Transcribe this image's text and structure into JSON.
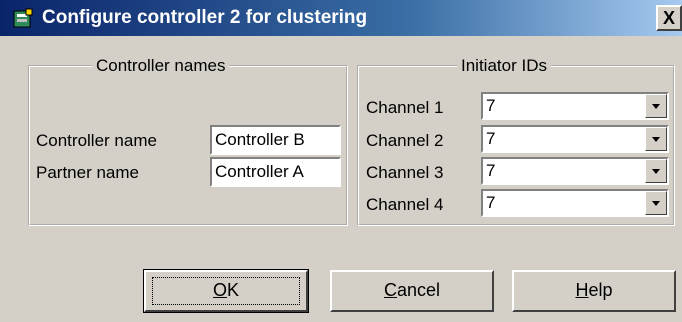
{
  "window": {
    "title": "Configure controller 2 for clustering",
    "close_label": "X"
  },
  "controller_names": {
    "legend": "Controller names",
    "controller_name_label": "Controller name",
    "controller_name_value": "Controller B",
    "partner_name_label": "Partner name",
    "partner_name_value": "Controller A"
  },
  "initiator_ids": {
    "legend": "Initiator IDs",
    "channels": [
      {
        "label": "Channel 1",
        "value": "7"
      },
      {
        "label": "Channel 2",
        "value": "7"
      },
      {
        "label": "Channel 3",
        "value": "7"
      },
      {
        "label": "Channel 4",
        "value": "7"
      }
    ]
  },
  "buttons": {
    "ok_mnemonic": "O",
    "ok_rest": "K",
    "cancel_mnemonic": "C",
    "cancel_rest": "ancel",
    "help_mnemonic": "H",
    "help_rest": "elp"
  },
  "colors": {
    "face": "#d4d0c8",
    "title_start": "#0a246a",
    "title_end": "#a6caf0"
  }
}
